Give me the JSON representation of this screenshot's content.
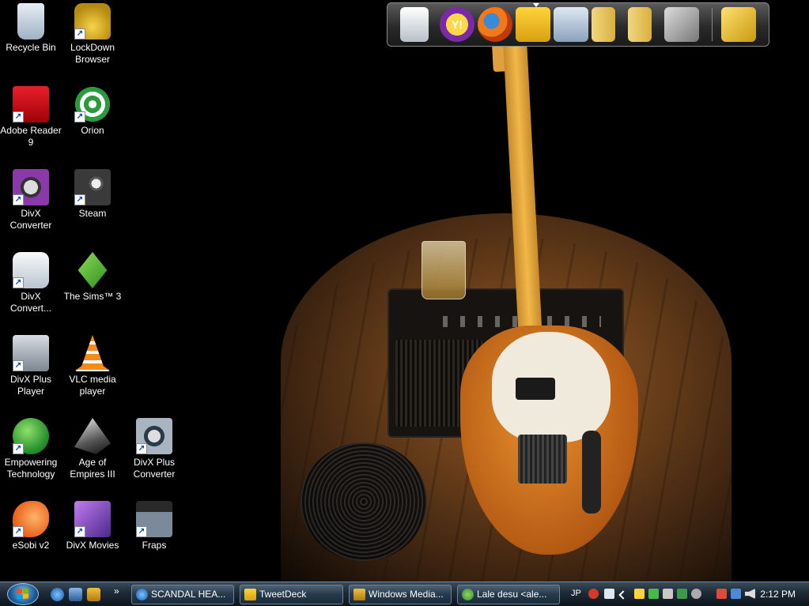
{
  "desktop_icons": [
    {
      "label": "Recycle Bin",
      "icon": "recycle-bin-icon",
      "shortcut": false
    },
    {
      "label": "LockDown Browser",
      "icon": "padlock-icon",
      "shortcut": true
    },
    {
      "label": "Adobe Reader 9",
      "icon": "adobe-reader-icon",
      "shortcut": true
    },
    {
      "label": "Orion",
      "icon": "orion-target-icon",
      "shortcut": true
    },
    {
      "label": "DivX Converter",
      "icon": "divx-converter-icon",
      "shortcut": true
    },
    {
      "label": "Steam",
      "icon": "steam-icon",
      "shortcut": true
    },
    {
      "label": "DivX Convert...",
      "icon": "divx-convert-icon",
      "shortcut": true
    },
    {
      "label": "The Sims™ 3",
      "icon": "sims-plumbob-icon",
      "shortcut": true
    },
    {
      "label": "DivX Plus Player",
      "icon": "divx-player-icon",
      "shortcut": true
    },
    {
      "label": "VLC media player",
      "icon": "vlc-cone-icon",
      "shortcut": true
    },
    {
      "label": "Empowering Technology",
      "icon": "empowering-e-icon",
      "shortcut": true
    },
    {
      "label": "Age of Empires III",
      "icon": "age-of-empires-icon",
      "shortcut": true
    },
    {
      "label": "DivX Plus Converter",
      "icon": "divx-plus-converter-icon",
      "shortcut": true
    },
    {
      "label": "eSobi v2",
      "icon": "esobi-fish-icon",
      "shortcut": true
    },
    {
      "label": "DivX Movies",
      "icon": "divx-movies-icon",
      "shortcut": true
    },
    {
      "label": "Fraps",
      "icon": "fraps-icon",
      "shortcut": true
    },
    {
      "shortcut_glyph": "↗"
    }
  ],
  "dock": {
    "items": [
      {
        "icon": "notepad-icon"
      },
      {
        "icon": "yahoo-messenger-icon",
        "text": "Y!"
      },
      {
        "icon": "firefox-icon"
      },
      {
        "icon": "tweetdeck-bird-icon"
      },
      {
        "icon": "open-folder-icon"
      },
      {
        "icon": "folder-icon"
      },
      {
        "icon": "folder-icon"
      },
      {
        "icon": "tools-icon"
      },
      {
        "icon": "hammer-wrench-icon"
      }
    ]
  },
  "taskbar": {
    "chevron": "»",
    "tasks": [
      {
        "label": "SCANDAL HEA...",
        "icon": "internet-explorer-icon"
      },
      {
        "label": "TweetDeck",
        "icon": "tweetdeck-icon"
      },
      {
        "label": "Windows Media...",
        "icon": "windows-media-player-icon"
      },
      {
        "label": "Lale desu <ale...",
        "icon": "messenger-icon"
      }
    ],
    "tray": {
      "language": "JP",
      "clock": "2:12 PM"
    }
  },
  "colors": {
    "taskbar_top": "#3b4a58",
    "taskbar_bottom": "#0d151d",
    "guitar": "#e8902e",
    "desktop_bg": "#000000"
  }
}
